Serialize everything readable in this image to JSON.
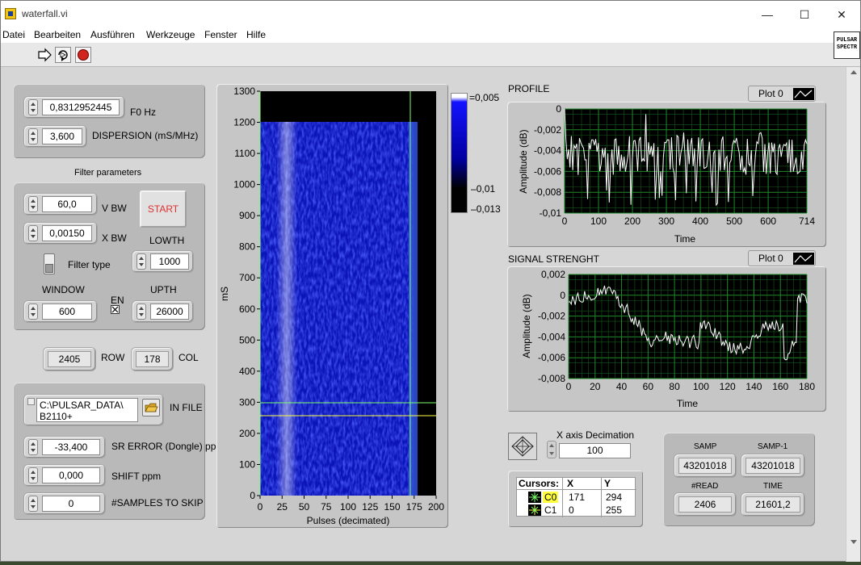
{
  "window": {
    "title": "waterfall.vi",
    "controls": {
      "minimize": "—",
      "maximize": "☐",
      "close": "✕"
    }
  },
  "menu": [
    "Datei",
    "Bearbeiten",
    "Ausführen",
    "Werkzeuge",
    "Fenster",
    "Hilfe"
  ],
  "toolbar": {
    "run": "run-arrow-icon",
    "run_continuously": "run-continuously-icon",
    "abort": "abort-icon"
  },
  "logo_text": [
    "PULSAR",
    "SPECTR"
  ],
  "controls": {
    "f0": {
      "value": "0,8312952445",
      "label": "F0 Hz"
    },
    "dispersion": {
      "value": "3,600",
      "label": "DISPERSION (mS/MHz)"
    },
    "filter_title": "Filter parameters",
    "vbw": {
      "value": "60,0",
      "label": "V BW"
    },
    "xbw": {
      "value": "0,00150",
      "label": "X BW"
    },
    "start_label": "START",
    "lowth": {
      "value": "1000",
      "label": "LOWTH"
    },
    "filter_type_label": "Filter type",
    "window": {
      "value": "600",
      "label": "WINDOW"
    },
    "en_label": "EN",
    "upth": {
      "value": "26000",
      "label": "UPTH"
    },
    "row": {
      "value": "2405",
      "label": "ROW"
    },
    "col": {
      "value": "178",
      "label": "COL"
    },
    "in_file": {
      "value_line1": "C:\\PULSAR_DATA\\",
      "value_line2": "B2110+",
      "label": "IN FILE"
    },
    "sr_error": {
      "value": "-33,400",
      "label": "SR ERROR (Dongle) ppm"
    },
    "shift": {
      "value": "0,000",
      "label": "SHIFT ppm"
    },
    "skip": {
      "value": "0",
      "label": "#SAMPLES TO SKIP"
    }
  },
  "waterfall": {
    "ylabel": "mS",
    "xlabel": "Pulses (decimated)",
    "yticks": [
      "0",
      "100",
      "200",
      "300",
      "400",
      "500",
      "600",
      "700",
      "800",
      "900",
      "1000",
      "1100",
      "1200",
      "1300"
    ],
    "xticks": [
      "0",
      "25",
      "50",
      "75",
      "100",
      "125",
      "150",
      "175",
      "200"
    ],
    "colorbar": [
      "0,005",
      "-0,01",
      "-0,013"
    ]
  },
  "profile": {
    "title": "PROFILE",
    "legend": "Plot 0",
    "xlabel": "Time",
    "ylabel": "Amplitude (dB)",
    "xticks": [
      "0",
      "100",
      "200",
      "300",
      "400",
      "500",
      "600",
      "714"
    ],
    "yticks": [
      "0",
      "-0,002",
      "-0,004",
      "-0,006",
      "-0,008",
      "-0,01"
    ]
  },
  "signal": {
    "title": "SIGNAL STRENGHT",
    "legend": "Plot 0",
    "xlabel": "Time",
    "ylabel": "Amplitude (dB)",
    "xticks": [
      "0",
      "20",
      "40",
      "60",
      "80",
      "100",
      "120",
      "140",
      "160",
      "180"
    ],
    "yticks": [
      "0,002",
      "0",
      "-0,002",
      "-0,004",
      "-0,006",
      "-0,008"
    ]
  },
  "decimation": {
    "label": "X axis Decimation",
    "value": "100"
  },
  "cursors": {
    "headers": [
      "Cursors:",
      "X",
      "Y"
    ],
    "rows": [
      {
        "name": "C0",
        "x": "171",
        "y": "294"
      },
      {
        "name": "C1",
        "x": "0",
        "y": "255"
      }
    ]
  },
  "stats": {
    "samp": {
      "label": "SAMP",
      "value": "43201018"
    },
    "samp1": {
      "label": "SAMP-1",
      "value": "43201018"
    },
    "read": {
      "label": "#READ",
      "value": "2406"
    },
    "time": {
      "label": "TIME",
      "value": "21601,2"
    }
  }
}
